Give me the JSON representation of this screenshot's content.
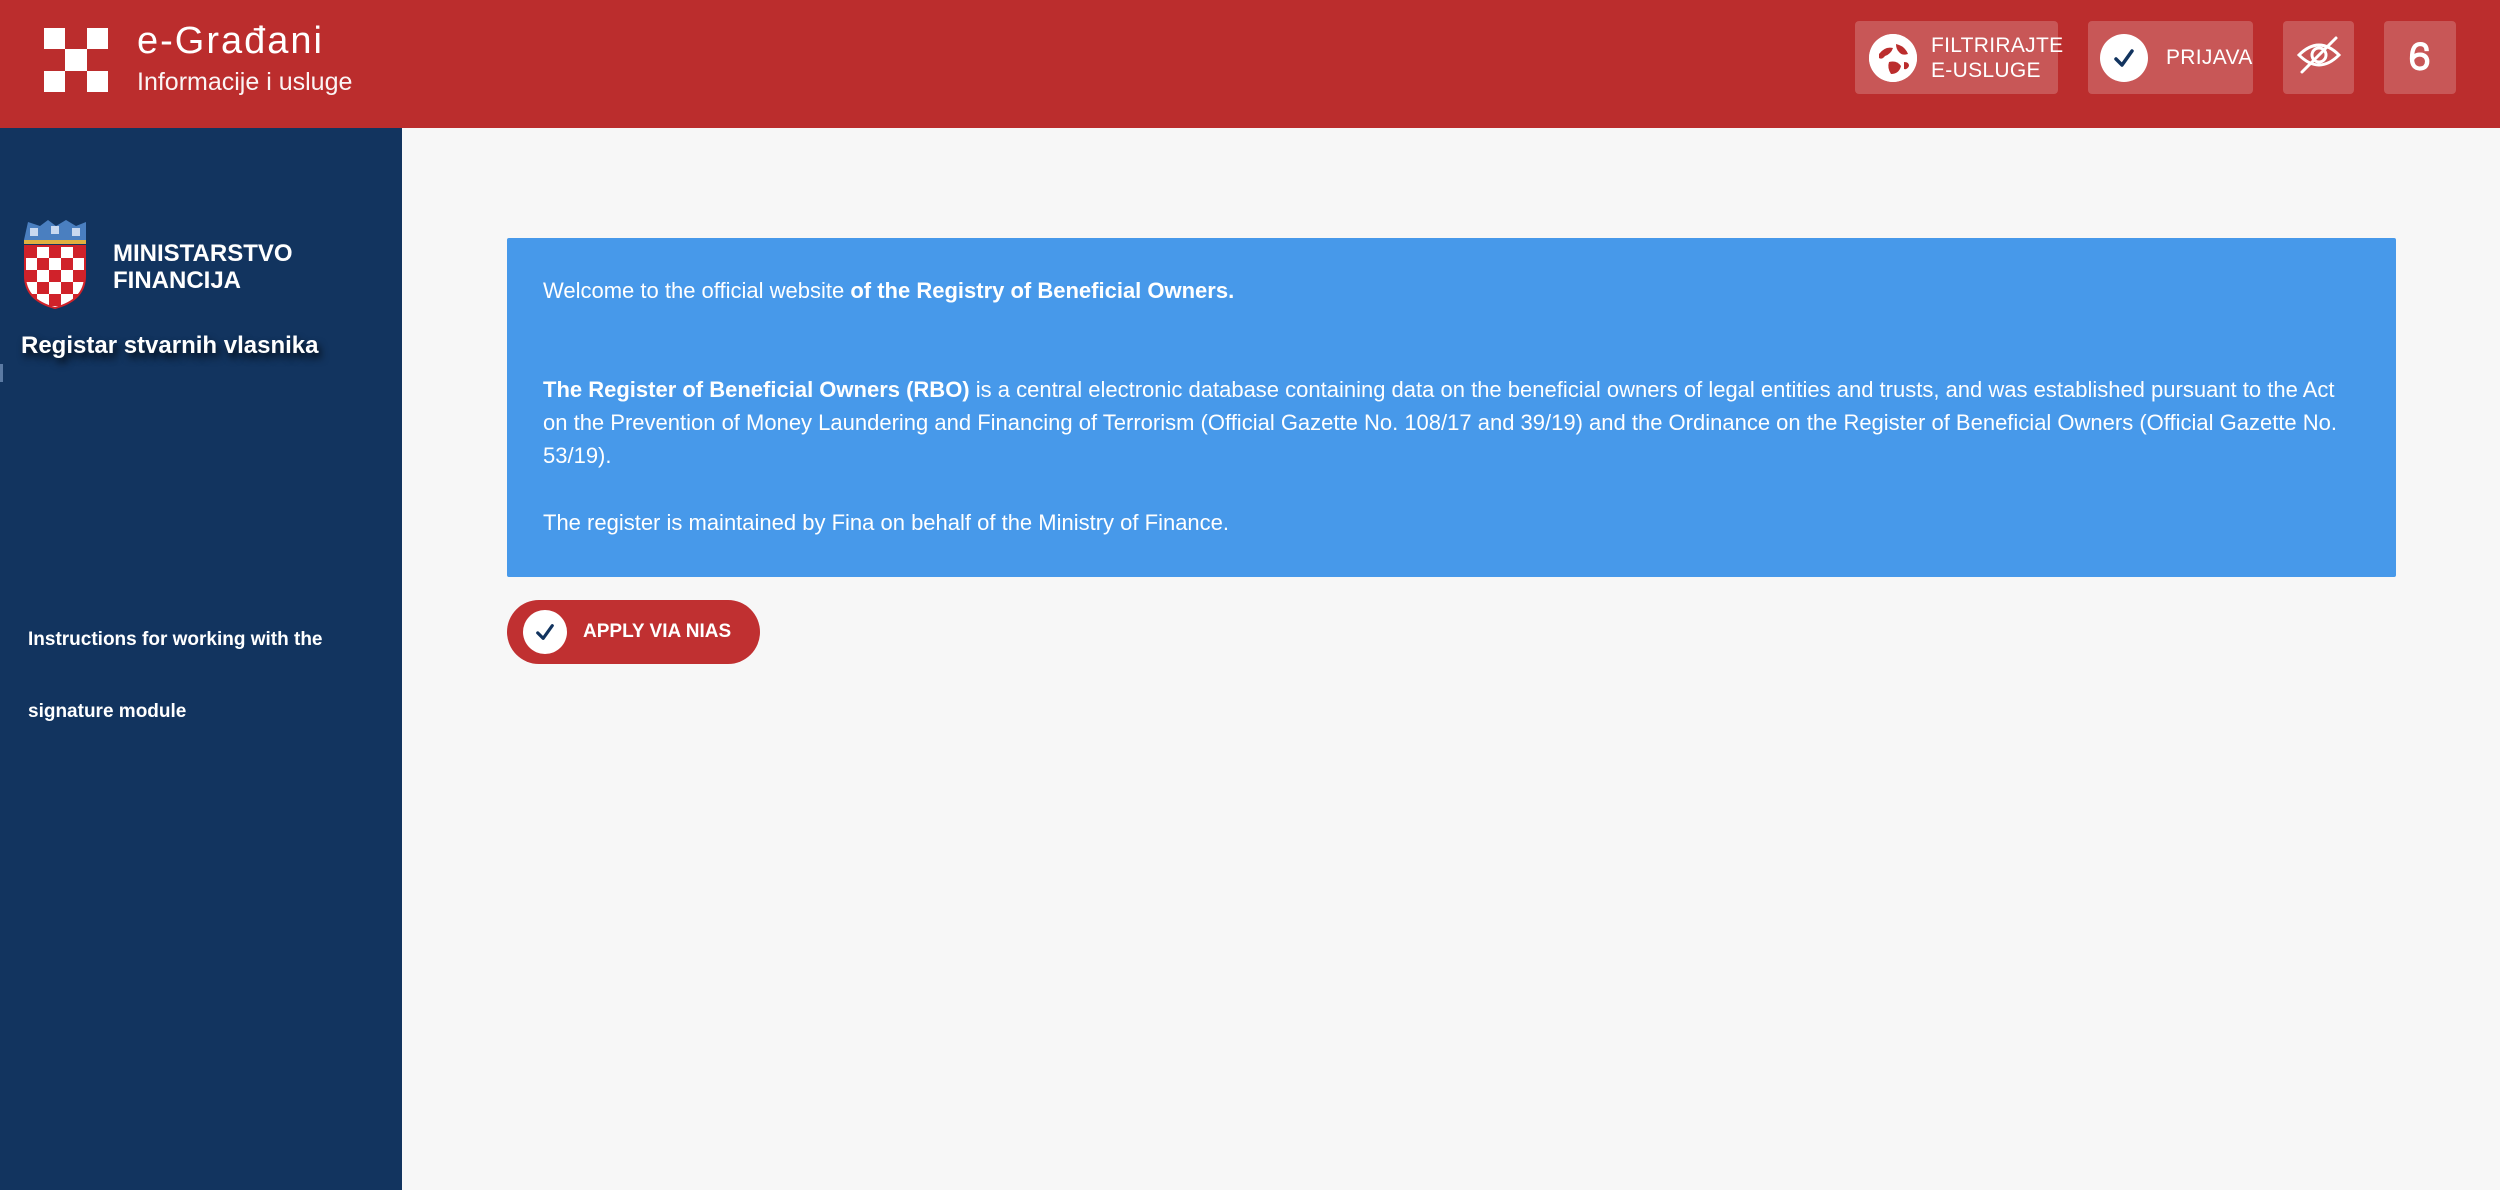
{
  "colors": {
    "header_bg": "#bb2d2d",
    "sidebar_bg": "#12345f",
    "info_box_bg": "#4799ea",
    "apply_button_bg": "#c03031",
    "page_bg": "#f7f7f7"
  },
  "header": {
    "brand": {
      "title": "e-Građani",
      "subtitle": "Informacije i usluge",
      "logo_icon": "checkerboard-logo-icon"
    },
    "filter_button": {
      "icon": "globe-filter-icon",
      "line1": "FILTRIRAJTE",
      "line2": "E-USLUGE"
    },
    "login_button": {
      "icon": "check-circle-icon",
      "label": "PRIJAVA"
    },
    "visibility_button": {
      "icon": "eye-slash-icon"
    },
    "language_button": {
      "glyph": "Ꮾ"
    }
  },
  "sidebar": {
    "ministry_line1": "MINISTARSTVO",
    "ministry_line2": "FINANCIJA",
    "register_title": "Registar stvarnih vlasnika",
    "instructions_link": "Instructions for working with the signature module"
  },
  "main": {
    "welcome_prefix": "Welcome to the official website ",
    "welcome_bold": "of the Registry of Beneficial Owners",
    "welcome_suffix": ".",
    "rbo_bold": "The Register of Beneficial Owners (RBO)",
    "rbo_text": " is a central electronic database containing data on the beneficial owners of legal entities and trusts, and was established pursuant to the Act on the Prevention of Money Laundering and Financing of Terrorism (Official Gazette No. 108/17 and 39/19) and the Ordinance on the Register of Beneficial Owners (Official Gazette No. 53/19).",
    "maintained_text": "The register is maintained by Fina on behalf of the Ministry of Finance.",
    "apply_button": {
      "icon": "check-circle-icon",
      "label": "APPLY VIA NIAS"
    }
  }
}
